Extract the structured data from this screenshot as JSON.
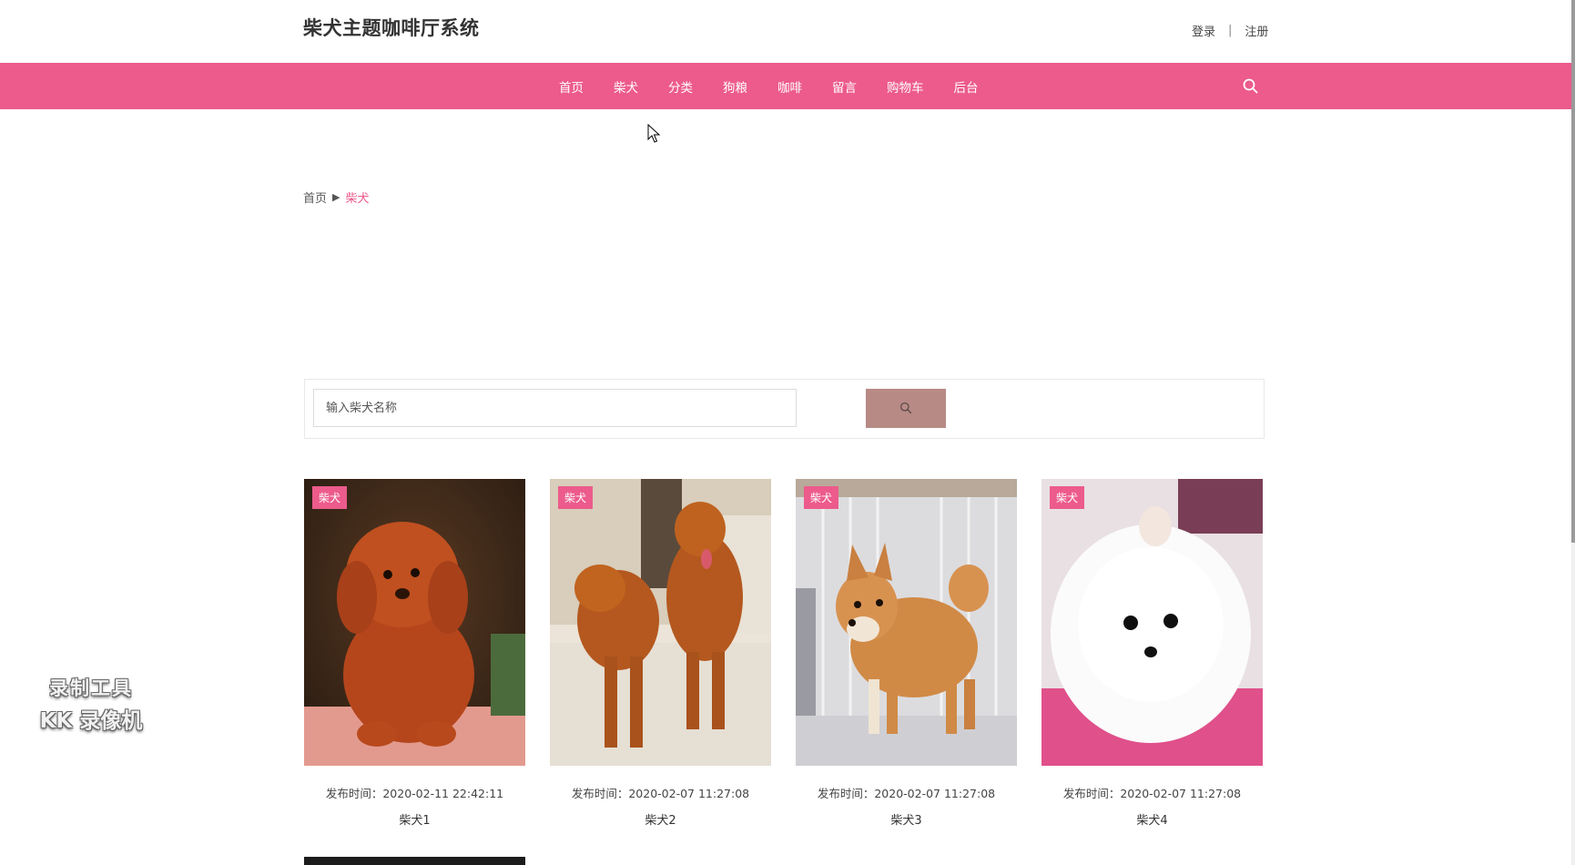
{
  "header": {
    "site_title": "柴犬主题咖啡厅系统",
    "login": "登录",
    "separator": "|",
    "register": "注册"
  },
  "nav": {
    "items": [
      "首页",
      "柴犬",
      "分类",
      "狗粮",
      "咖啡",
      "留言",
      "购物车",
      "后台"
    ],
    "search_icon": "search-icon"
  },
  "breadcrumb": {
    "home": "首页",
    "arrow": "▶",
    "current": "柴犬"
  },
  "search": {
    "placeholder": "输入柴犬名称",
    "button_icon": "search-icon"
  },
  "cards": [
    {
      "tag": "柴犬",
      "time": "发布时间：2020-02-11 22:42:11",
      "title": "柴犬1"
    },
    {
      "tag": "柴犬",
      "time": "发布时间：2020-02-07 11:27:08",
      "title": "柴犬2"
    },
    {
      "tag": "柴犬",
      "time": "发布时间：2020-02-07 11:27:08",
      "title": "柴犬3"
    },
    {
      "tag": "柴犬",
      "time": "发布时间：2020-02-07 11:27:08",
      "title": "柴犬4"
    }
  ],
  "watermark": {
    "line1": "录制工具",
    "line2": "KK 录像机"
  },
  "colors": {
    "accent": "#ec5b8b",
    "search_button": "#b88a86"
  }
}
